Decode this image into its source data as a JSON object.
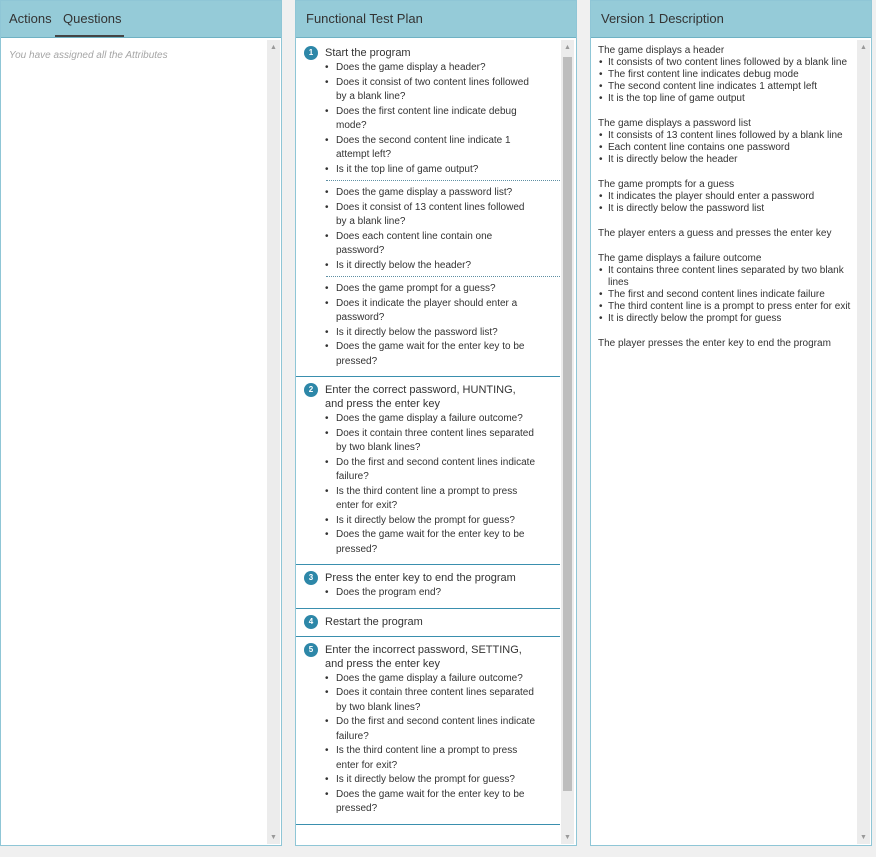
{
  "left_panel": {
    "tabs": [
      "Actions",
      "Questions"
    ],
    "active_tab": "Questions",
    "empty_message": "You have assigned all the Attributes"
  },
  "test_plan": {
    "title": "Functional Test Plan",
    "steps": [
      {
        "number": "1",
        "title": "Start the program",
        "groups": [
          [
            "Does the game display a header?",
            "Does it consist of two content lines followed by a blank line?",
            "Does the first content line indicate debug mode?",
            "Does the second content line indicate 1 attempt left?",
            "Is it the top line of game output?"
          ],
          [
            "Does the game display a password list?",
            "Does it consist of 13 content lines followed by a blank line?",
            "Does each content line contain one password?",
            "Is it directly below the header?"
          ],
          [
            "Does the game prompt for a guess?",
            "Does it indicate the player should enter a password?",
            "Is it directly below the password list?",
            "Does the game wait for the enter key to be pressed?"
          ]
        ]
      },
      {
        "number": "2",
        "title": "Enter the correct password, HUNTING, and press the enter key",
        "groups": [
          [
            "Does the game display a failure outcome?",
            "Does it contain three content lines separated by two blank lines?",
            "Do the first and second content lines indicate failure?",
            "Is the third content line a prompt to press enter for exit?",
            "Is it directly below the prompt for guess?",
            "Does the game wait for the enter key to be pressed?"
          ]
        ]
      },
      {
        "number": "3",
        "title": "Press the enter key to end the program",
        "groups": [
          [
            "Does the program end?"
          ]
        ]
      },
      {
        "number": "4",
        "title": "Restart the program",
        "groups": []
      },
      {
        "number": "5",
        "title": "Enter the incorrect password, SETTING, and press the enter key",
        "groups": [
          [
            "Does the game display a failure outcome?",
            "Does it contain three content lines separated by two blank lines?",
            "Do the first and second content lines indicate failure?",
            "Is the third content line a prompt to press enter for exit?",
            "Is it directly below the prompt for guess?",
            "Does the game wait for the enter key to be pressed?"
          ]
        ]
      }
    ]
  },
  "description": {
    "title": "Version 1 Description",
    "blocks": [
      {
        "heading": "The game displays a header",
        "items": [
          "It consists of two content lines followed by a blank line",
          "The first content line indicates debug mode",
          "The second content line indicates 1 attempt left",
          "It is the top line of game output"
        ]
      },
      {
        "heading": "The game displays a password list",
        "items": [
          "It consists of 13 content lines followed by a blank line",
          "Each content line contains one password",
          "It is directly below the header"
        ]
      },
      {
        "heading": "The game prompts for a guess",
        "items": [
          "It indicates the player should enter a password",
          "It is directly below the password list"
        ]
      },
      {
        "heading": "The player enters a guess and presses the enter key",
        "items": []
      },
      {
        "heading": "The game displays a failure outcome",
        "items": [
          "It contains three content lines separated by two blank lines",
          "The first and second content lines indicate failure",
          "The third content line is a prompt to press enter for exit",
          "It is directly below the prompt for guess"
        ]
      },
      {
        "heading": "The player presses the enter key to end the program",
        "items": []
      }
    ]
  },
  "colors": {
    "header_bg": "#95cbd8",
    "badge": "#2d87a8",
    "step_border": "#3a8fae"
  },
  "icons": [
    "scroll-up-arrow-icon",
    "scroll-down-arrow-icon",
    "step-number-badge"
  ]
}
